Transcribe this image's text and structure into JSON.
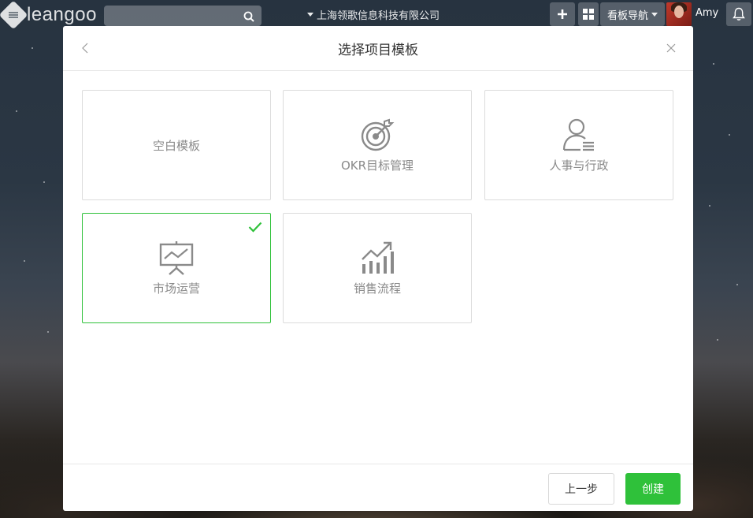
{
  "topbar": {
    "logo_text": "leangoo",
    "search_placeholder": "",
    "org_name": "上海领歌信息科技有限公司",
    "add_icon": "plus-icon",
    "grid_icon": "grid-icon",
    "board_nav_label": "看板导航",
    "user_name": "Amy",
    "bell_icon": "bell-icon"
  },
  "modal": {
    "title": "选择项目模板",
    "templates": [
      {
        "label": "空白模板",
        "icon": "none",
        "selected": false
      },
      {
        "label": "OKR目标管理",
        "icon": "target-icon",
        "selected": false
      },
      {
        "label": "人事与行政",
        "icon": "user-list-icon",
        "selected": false
      },
      {
        "label": "市场运营",
        "icon": "presentation-icon",
        "selected": true
      },
      {
        "label": "销售流程",
        "icon": "growth-chart-icon",
        "selected": false
      }
    ],
    "footer": {
      "prev_label": "上一步",
      "create_label": "创建"
    }
  },
  "colors": {
    "accent": "#2fc13a",
    "icon_gray": "#8a8a8a"
  }
}
